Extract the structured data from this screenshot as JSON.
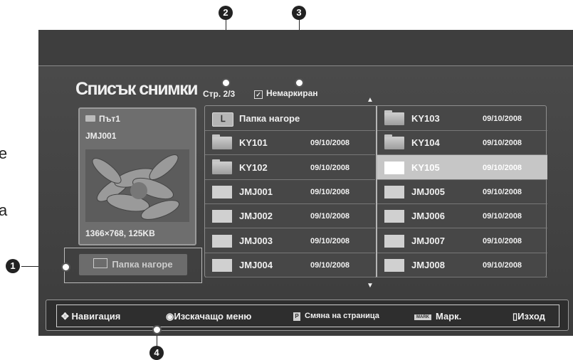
{
  "margin_text": {
    "top": "те",
    "bottom": "a"
  },
  "callouts": [
    "1",
    "2",
    "3",
    "4"
  ],
  "screen": {
    "title": "Списък снимки",
    "page_indicator": "Стр. 2/3",
    "mark_status": "Немаркиран",
    "scroll_up": "▲",
    "scroll_down": "▼",
    "preview": {
      "path": "Път1",
      "filename": "JMJ001",
      "info": "1366×768, 125KB"
    },
    "up_folder_button": "Папка нагоре",
    "file_list": {
      "left": [
        {
          "type": "up",
          "icon_glyph": "ᒪ",
          "name": "Папка нагоре",
          "date": ""
        },
        {
          "type": "folder",
          "name": "KY101",
          "date": "09/10/2008"
        },
        {
          "type": "folder",
          "name": "KY102",
          "date": "09/10/2008"
        },
        {
          "type": "photo",
          "name": "JMJ001",
          "date": "09/10/2008"
        },
        {
          "type": "photo",
          "name": "JMJ002",
          "date": "09/10/2008"
        },
        {
          "type": "photo",
          "name": "JMJ003",
          "date": "09/10/2008"
        },
        {
          "type": "photo",
          "name": "JMJ004",
          "date": "09/10/2008"
        }
      ],
      "right": [
        {
          "type": "folder",
          "name": "KY103",
          "date": "09/10/2008"
        },
        {
          "type": "folder",
          "name": "KY104",
          "date": "09/10/2008"
        },
        {
          "type": "photo",
          "name": "KY105",
          "date": "09/10/2008",
          "selected": true
        },
        {
          "type": "photo",
          "name": "JMJ005",
          "date": "09/10/2008"
        },
        {
          "type": "photo",
          "name": "JMJ006",
          "date": "09/10/2008"
        },
        {
          "type": "photo",
          "name": "JMJ007",
          "date": "09/10/2008"
        },
        {
          "type": "photo",
          "name": "JMJ008",
          "date": "09/10/2008"
        }
      ]
    },
    "footer": {
      "navigation": "Навигация",
      "popup_menu": "Изскачащо меню",
      "page_key": "P",
      "page_change": "Смяна на страница",
      "mark_key": "MARK",
      "mark": "Марк.",
      "exit": "Изход"
    }
  },
  "colors": {
    "screen_bg": "#3a3a3a",
    "selected_row": "#c6c6c6",
    "text": "#f0f0f0"
  }
}
